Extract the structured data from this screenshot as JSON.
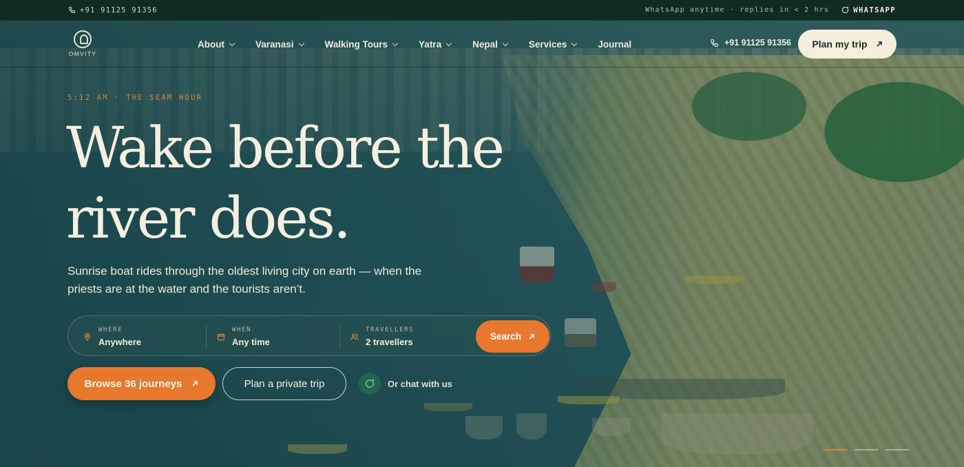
{
  "topbar": {
    "phone": "+91 91125 91356",
    "note": "WhatsApp anytime · replies in < 2 hrs",
    "whatsapp_label": "WHATSAPP"
  },
  "brand": {
    "name": "OMVITY"
  },
  "nav": {
    "items": [
      {
        "label": "About",
        "has_dropdown": true
      },
      {
        "label": "Varanasi",
        "has_dropdown": true
      },
      {
        "label": "Walking Tours",
        "has_dropdown": true
      },
      {
        "label": "Yatra",
        "has_dropdown": true
      },
      {
        "label": "Nepal",
        "has_dropdown": true
      },
      {
        "label": "Services",
        "has_dropdown": true
      },
      {
        "label": "Journal",
        "has_dropdown": false
      }
    ],
    "phone": "+91 91125 91356",
    "cta_label": "Plan my trip"
  },
  "hero": {
    "eyebrow": "5:12 AM · THE SEAM HOUR",
    "headline_line1": "Wake before the",
    "headline_line2": "river does.",
    "subtitle": "Sunrise boat rides through the oldest living city on earth — when the priests are at the water and the tourists aren’t."
  },
  "search": {
    "where": {
      "label": "WHERE",
      "value": "Anywhere",
      "icon": "map-pin-icon"
    },
    "when": {
      "label": "WHEN",
      "value": "Any time",
      "icon": "calendar-icon"
    },
    "travellers": {
      "label": "TRAVELLERS",
      "value": "2 travellers",
      "icon": "people-icon"
    },
    "button_label": "Search"
  },
  "cta": {
    "browse_label": "Browse 36 journeys",
    "private_label": "Plan a private trip",
    "chat_label": "Or chat with us"
  },
  "slides": {
    "count": 3,
    "active_index": 0
  },
  "colors": {
    "accent": "#e8782e",
    "eyebrow": "#d68a3a",
    "cream": "#f5eedc",
    "topbar": "#0f2b24"
  }
}
